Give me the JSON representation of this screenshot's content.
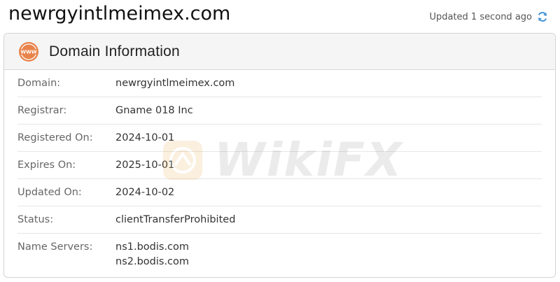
{
  "page": {
    "title": "newrgyintlmeimex.com",
    "updated_text": "Updated 1 second ago"
  },
  "card": {
    "title": "Domain Information",
    "header_icon": "www-globe-icon",
    "accent_color": "#e8834a"
  },
  "rows": [
    {
      "label": "Domain:",
      "value": "newrgyintlmeimex.com"
    },
    {
      "label": "Registrar:",
      "value": "Gname 018 Inc"
    },
    {
      "label": "Registered On:",
      "value": "2024-10-01"
    },
    {
      "label": "Expires On:",
      "value": "2025-10-01"
    },
    {
      "label": "Updated On:",
      "value": "2024-10-02"
    },
    {
      "label": "Status:",
      "value": "clientTransferProhibited"
    },
    {
      "label": "Name Servers:",
      "values": [
        "ns1.bodis.com",
        "ns2.bodis.com"
      ]
    }
  ],
  "watermark": {
    "text": "WikiFX"
  },
  "icons": {
    "refresh": "refresh-icon",
    "refresh_color": "#3a8fd6"
  }
}
